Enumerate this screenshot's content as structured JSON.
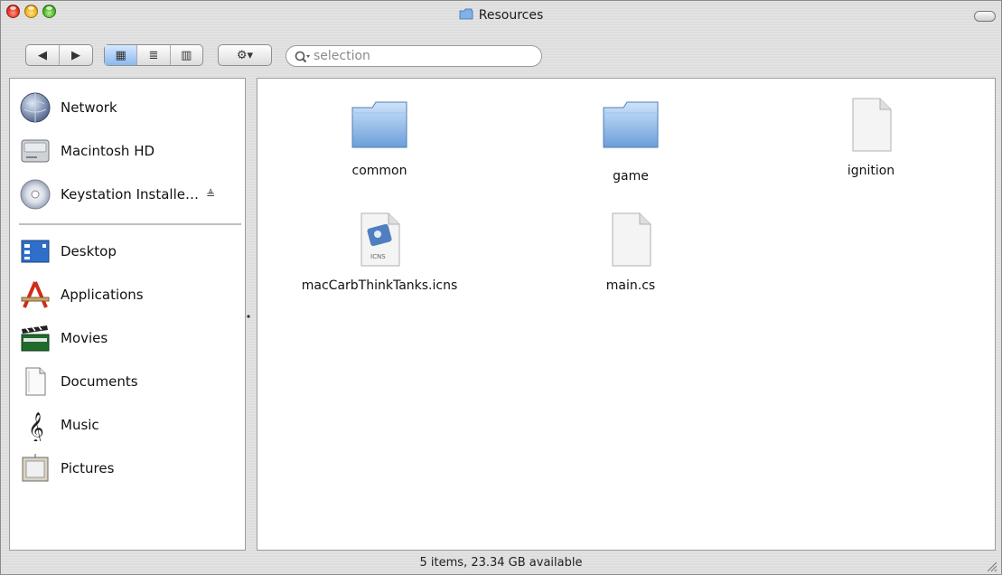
{
  "window": {
    "title": "Resources"
  },
  "toolbar": {
    "back_label": "◀",
    "forward_label": "▶",
    "view_icon_label": "▦",
    "view_list_label": "≣",
    "view_column_label": "▥",
    "action_label": "⚙▾",
    "search_placeholder": "selection"
  },
  "sidebar": {
    "volumes": [
      {
        "label": "Network",
        "icon": "network-icon"
      },
      {
        "label": "Macintosh HD",
        "icon": "hard-drive-icon"
      },
      {
        "label": "Keystation Installe…",
        "icon": "cd-icon",
        "eject": "≜"
      }
    ],
    "places": [
      {
        "label": "Desktop",
        "icon": "desktop-icon"
      },
      {
        "label": "Applications",
        "icon": "applications-icon"
      },
      {
        "label": "Movies",
        "icon": "movies-icon"
      },
      {
        "label": "Documents",
        "icon": "documents-icon"
      },
      {
        "label": "Music",
        "icon": "music-icon"
      },
      {
        "label": "Pictures",
        "icon": "pictures-icon"
      }
    ]
  },
  "files": [
    {
      "name": "common",
      "kind": "folder"
    },
    {
      "name": "game",
      "kind": "folder"
    },
    {
      "name": "ignition",
      "kind": "document"
    },
    {
      "name": "macCarbThinkTanks.icns",
      "kind": "icns",
      "badge": "ICNS"
    },
    {
      "name": "main.cs",
      "kind": "document"
    }
  ],
  "status": {
    "text": "5 items, 23.34 GB available"
  }
}
